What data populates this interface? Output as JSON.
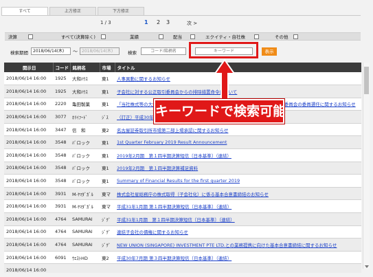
{
  "tabs": [
    {
      "label": "すべて"
    },
    {
      "label": "上方修正"
    },
    {
      "label": "下方修正"
    }
  ],
  "pager": {
    "count": "1 / 3",
    "pages": [
      "1",
      "2",
      "3"
    ],
    "current": "1",
    "next": "次 >"
  },
  "filters": [
    {
      "label": "決算",
      "checked": false
    },
    {
      "label": "すべて(決算除く)",
      "checked": false
    },
    {
      "label": "業績",
      "checked": false
    },
    {
      "label": "配当",
      "checked": false
    },
    {
      "label": "エクイティ・自社株",
      "checked": false
    },
    {
      "label": "その他",
      "checked": false
    }
  ],
  "search": {
    "period_label": "検索期間",
    "date_from": "2018/06/14(木)",
    "date_to": "2018/06/14(木)",
    "tilde": "〜",
    "search_label": "検索",
    "code_placeholder": "コード/銘柄名",
    "keyword_placeholder": "キーワード",
    "button": "表示"
  },
  "table": {
    "headers": [
      "開示日",
      "コード",
      "銘柄名",
      "市場",
      "タイトル"
    ],
    "rows": [
      [
        "2018/06/14 16:00",
        "1925",
        "大和ﾊｳｽ",
        "東1",
        "人事異動に関するお知らせ"
      ],
      [
        "2018/06/14 16:00",
        "1925",
        "大和ﾊｳｽ",
        "東1",
        "子会社に対する公正取引委員会からの排除措置命令について"
      ],
      [
        "2018/06/14 16:00",
        "2220",
        "亀田製菓",
        "東1",
        "「当社株式等の大規模買付行為に関する対応策（買収防衛策）」の継続に関する独立委員会の委員選任に関するお知らせ"
      ],
      [
        "2018/06/14 16:00",
        "3077",
        "ﾎﾘｲﾌｰﾄﾞ",
        "ｼﾞｽ",
        "（訂正）平成30年3月期 決算短信〔日本基準〕（連結）の一部訂正について"
      ],
      [
        "2018/06/14 16:00",
        "3447",
        "信　和",
        "東2",
        "名古屋証券取引所市場第二部上場承認に関するお知らせ"
      ],
      [
        "2018/06/14 16:00",
        "3548",
        "ﾊﾞロック",
        "東1",
        "1st Quarter February 2019 Result Announcement"
      ],
      [
        "2018/06/14 16:00",
        "3548",
        "ﾊﾞロック",
        "東1",
        "2019年2月期　第１四半期決算短信〔日本基準〕（連結）"
      ],
      [
        "2018/06/14 16:00",
        "3548",
        "ﾊﾞロック",
        "東1",
        "2019年2月期　第１四半期決算補足資料"
      ],
      [
        "2018/06/14 16:00",
        "3548",
        "ﾊﾞロック",
        "東1",
        "Summary of Financial Results for the first quarter 2019"
      ],
      [
        "2018/06/14 16:00",
        "3931",
        "M-ﾔﾏﾀﾞｶﾞﾙ",
        "東マ",
        "株式会社星総務庁の株式取得（子会社化）に係る基本合意書締結のお知らせ"
      ],
      [
        "2018/06/14 16:00",
        "3931",
        "M-ﾔﾏﾀﾞｶﾞﾙ",
        "東マ",
        "平成31年1月期 第１四半期決算短信〔日本基準〕（連結）"
      ],
      [
        "2018/06/14 16:00",
        "4764",
        "SAMURAI",
        "ｼﾞｸﾞ",
        "平成31年1月期　第１四半期決算短信〔日本基準〕（連結）"
      ],
      [
        "2018/06/14 16:00",
        "4764",
        "SAMURAI",
        "ｼﾞｸﾞ",
        "連結子会社の債権に関するお知らせ"
      ],
      [
        "2018/06/14 16:00",
        "4764",
        "SAMURAI",
        "ｼﾞｸﾞ",
        "NEW UNION (SINGAPORE) INVESTMENT PTE LTD.との業務提携に向けた基本合意書締結に関するお知らせ"
      ],
      [
        "2018/06/14 16:00",
        "6091",
        "ｳｴｽﾄHD",
        "東2",
        "平成30年7月期 第３四半期決算短信〔日本基準〕（連結）"
      ],
      [
        "2018/06/14 16:00",
        "",
        "",
        "",
        ""
      ]
    ]
  },
  "callout": {
    "text": "キーワードで検索可能",
    "color": "#e01818"
  },
  "colors": {
    "header_bg": "#3b3b3b",
    "link": "#1a3fc8",
    "button": "#f08c18"
  }
}
